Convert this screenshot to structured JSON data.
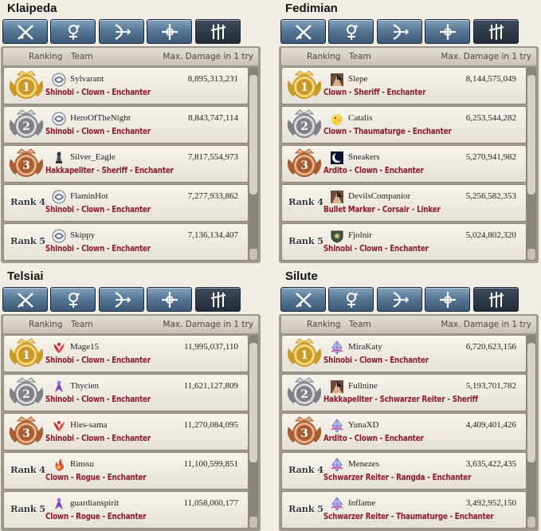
{
  "header_labels": {
    "ranking": "Ranking",
    "team": "Team",
    "damage": "Max. Damage in 1 try"
  },
  "tab_icons": [
    "swordsman-class-icon",
    "wizard-class-icon",
    "archer-class-icon",
    "cleric-class-icon",
    "scout-class-icon"
  ],
  "colors": {
    "gold": "#e2b23a",
    "silver": "#9ea2a6",
    "bronze": "#c87a4a",
    "class_text": "#8c1a2c",
    "tab_blue": "#577896",
    "tab_dark": "#222c38"
  },
  "panels": [
    {
      "server": "Klaipeda",
      "rows": [
        {
          "rank": "1",
          "team": "Sylvarant",
          "damage": "8,895,313,231",
          "classes": "Shinobi - Clown - Enchanter",
          "icon": "emblem-swirl-icon"
        },
        {
          "rank": "2",
          "team": "HeroOfTheNight",
          "damage": "8,843,747,114",
          "classes": "Shinobi - Clown - Enchanter",
          "icon": "emblem-swirl-icon"
        },
        {
          "rank": "3",
          "team": "Silver_Eagle",
          "damage": "7,817,554,973",
          "classes": "Hakkapeliter - Sheriff - Enchanter",
          "icon": "emblem-chess-icon"
        },
        {
          "rank": "Rank 4",
          "team": "FlaminHot",
          "damage": "7,277,933,862",
          "classes": "Shinobi - Clown - Enchanter",
          "icon": "emblem-swirl-icon"
        },
        {
          "rank": "Rank 5",
          "team": "Skippy",
          "damage": "7,136,134,407",
          "classes": "Shinobi - Clown - Enchanter",
          "icon": "emblem-swirl-icon"
        }
      ]
    },
    {
      "server": "Fedimian",
      "rows": [
        {
          "rank": "1",
          "team": "Slepe",
          "damage": "8,144,575,049",
          "classes": "Clown - Sheriff - Enchanter",
          "icon": "emblem-portrait-icon"
        },
        {
          "rank": "2",
          "team": "Catalis",
          "damage": "6,253,544,282",
          "classes": "Clown - Thaumaturge - Enchanter",
          "icon": "emblem-chick-icon"
        },
        {
          "rank": "3",
          "team": "Sneakers",
          "damage": "5,270,941,982",
          "classes": "Ardito - Clown - Enchanter",
          "icon": "emblem-moon-icon"
        },
        {
          "rank": "Rank 4",
          "team": "DevilsCompanior",
          "damage": "5,256,582,353",
          "classes": "Bullet Marker - Corsair - Linker",
          "icon": "emblem-portrait-icon"
        },
        {
          "rank": "Rank 5",
          "team": "Fjolnir",
          "damage": "5,024,802,320",
          "classes": "Shinobi - Clown - Enchanter",
          "icon": "emblem-shield-icon"
        }
      ]
    },
    {
      "server": "Telsiai",
      "rows": [
        {
          "rank": "1",
          "team": "Mage15",
          "damage": "11,995,037,110",
          "classes": "Shinobi - Clown - Enchanter",
          "icon": "emblem-red-wing-icon"
        },
        {
          "rank": "2",
          "team": "Thycien",
          "damage": "11,621,127,809",
          "classes": "Shinobi - Clown - Enchanter",
          "icon": "emblem-purple-figure-icon"
        },
        {
          "rank": "3",
          "team": "Hies-sama",
          "damage": "11,270,084,095",
          "classes": "Shinobi - Clown - Enchanter",
          "icon": "emblem-red-wing-icon"
        },
        {
          "rank": "Rank 4",
          "team": "Rinssu",
          "damage": "11,100,599,851",
          "classes": "Clown - Rogue - Enchanter",
          "icon": "emblem-flame-icon"
        },
        {
          "rank": "Rank 5",
          "team": "guardianspirit",
          "damage": "11,058,060,177",
          "classes": "Clown - Rogue - Enchanter",
          "icon": "emblem-purple-figure-icon"
        }
      ]
    },
    {
      "server": "Silute",
      "rows": [
        {
          "rank": "1",
          "team": "MiraKaty",
          "damage": "6,720,623,156",
          "classes": "Shinobi - Clown - Enchanter",
          "icon": "emblem-crystal-icon"
        },
        {
          "rank": "2",
          "team": "Fullnine",
          "damage": "5,193,701,782",
          "classes": "Hakkapeliter - Schwarzer Reiter - Sheriff",
          "icon": "emblem-portrait-icon"
        },
        {
          "rank": "3",
          "team": "YunaXD",
          "damage": "4,409,401,426",
          "classes": "Ardito - Clown - Enchanter",
          "icon": "emblem-crystal-icon"
        },
        {
          "rank": "Rank 4",
          "team": "Menezes",
          "damage": "3,635,422,435",
          "classes": "Schwarzer Reiter - Rangda - Enchanter",
          "icon": "emblem-crystal-icon"
        },
        {
          "rank": "Rank 5",
          "team": "Inflame",
          "damage": "3,492,952,150",
          "classes": "Schwarzer Reiter - Thaumaturge - Enchanter",
          "icon": "emblem-crystal-icon"
        }
      ]
    }
  ]
}
